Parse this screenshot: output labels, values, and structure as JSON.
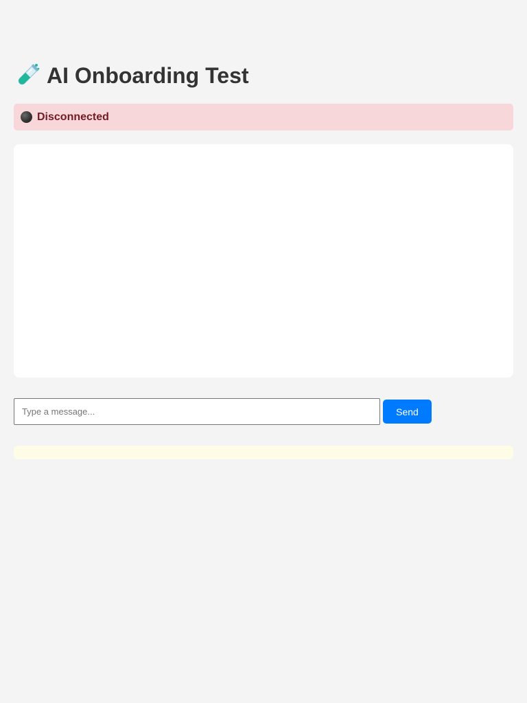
{
  "header": {
    "title": "AI Onboarding Test",
    "icon": "test-tube-icon"
  },
  "status": {
    "text": "Disconnected",
    "icon": "black-circle-icon",
    "background_color": "#f8d7da",
    "text_color": "#721c24"
  },
  "chat": {
    "messages": []
  },
  "composer": {
    "placeholder": "Type a message...",
    "value": "",
    "send_label": "Send",
    "send_color": "#007bff"
  },
  "notice": {
    "text": "",
    "background_color": "#fefbe6"
  }
}
